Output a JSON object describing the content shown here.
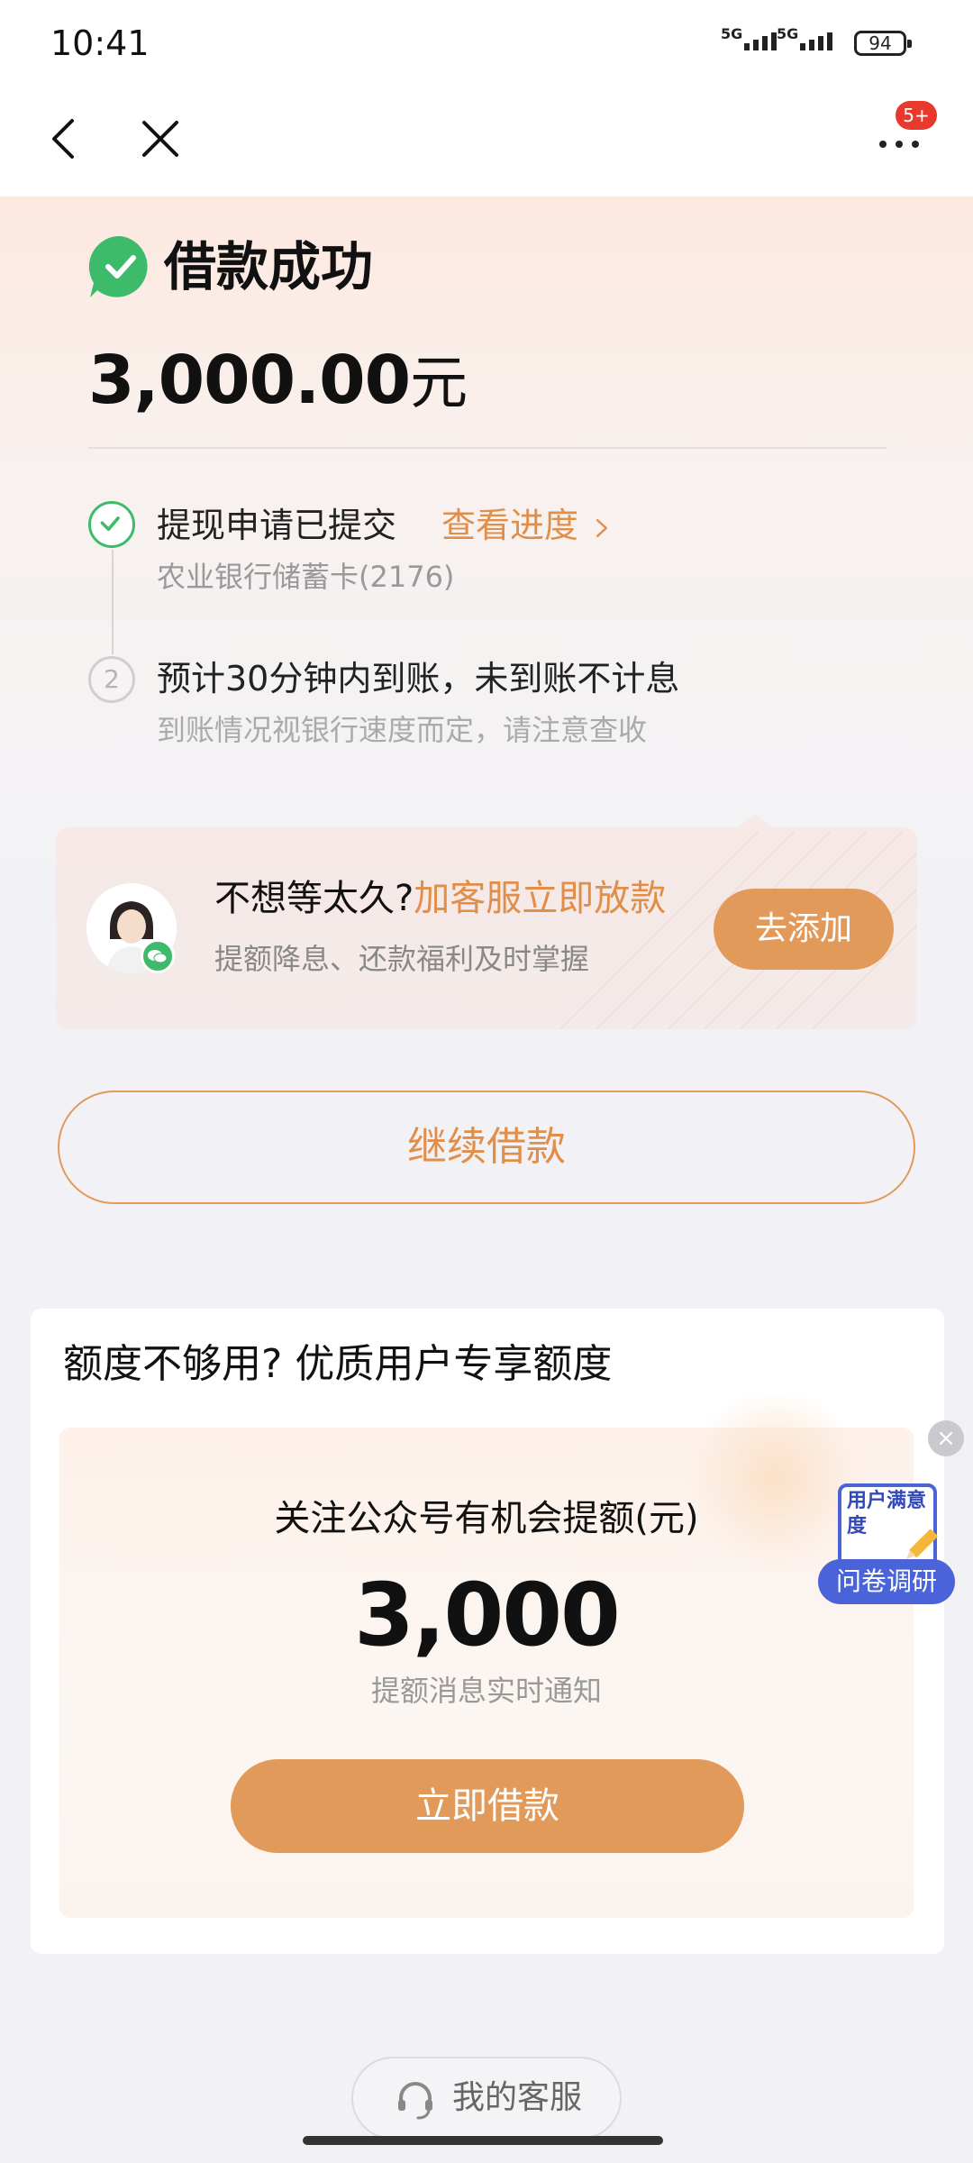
{
  "status_bar": {
    "time": "10:41",
    "signal1": "5G",
    "signal2": "5G",
    "battery": "94"
  },
  "nav": {
    "badge": "5+"
  },
  "result": {
    "title": "借款成功",
    "amount": "3,000.00",
    "unit": "元"
  },
  "steps": [
    {
      "title": "提现申请已提交",
      "link": "查看进度",
      "sub": "农业银行储蓄卡(2176)"
    },
    {
      "number": "2",
      "title": "预计30分钟内到账，未到账不计息",
      "sub": "到账情况视银行速度而定，请注意查收"
    }
  ],
  "promo": {
    "title_plain": "不想等太久?",
    "title_accent": "加客服立即放款",
    "subtitle": "提额降息、还款福利及时掌握",
    "button": "去添加"
  },
  "continue_button": "继续借款",
  "quota": {
    "title": "额度不够用? 优质用户专享额度",
    "label": "关注公众号有机会提额(元)",
    "amount": "3,000",
    "note": "提额消息实时通知",
    "button": "立即借款"
  },
  "survey": {
    "card_text": "用户满意度",
    "pill": "问卷调研",
    "close": "×"
  },
  "service": {
    "label": "我的客服"
  },
  "colors": {
    "accent": "#e29a5a",
    "success": "#3dbb6a",
    "survey": "#4a63d8"
  }
}
